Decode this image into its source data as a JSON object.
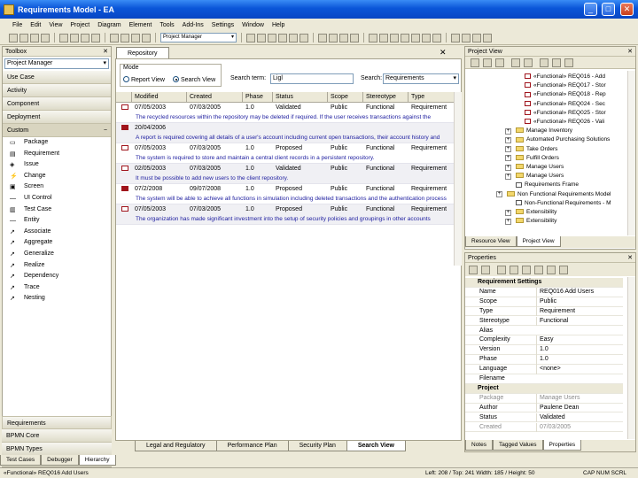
{
  "window": {
    "title": "Requirements Model - EA",
    "min": "_",
    "max": "□",
    "close": "✕"
  },
  "menu": [
    "File",
    "Edit",
    "View",
    "Project",
    "Diagram",
    "Element",
    "Tools",
    "Add-Ins",
    "Settings",
    "Window",
    "Help"
  ],
  "toolbar": {
    "workspace_combo": "Project Manager"
  },
  "toolbox": {
    "title": "Toolbox",
    "close": "✕",
    "perspective": "Project Manager",
    "categories_top": [
      "Use Case",
      "Activity",
      "Component",
      "Deployment"
    ],
    "custom_label": "Custom",
    "tools": [
      {
        "label": "Package",
        "icon": "▭"
      },
      {
        "label": "Requirement",
        "icon": "▤"
      },
      {
        "label": "Issue",
        "icon": "◈"
      },
      {
        "label": "Change",
        "icon": "⚡"
      },
      {
        "label": "Screen",
        "icon": "▣"
      },
      {
        "label": "UI Control",
        "icon": "—"
      },
      {
        "label": "Test Case",
        "icon": "▥"
      },
      {
        "label": "Entity",
        "icon": "—"
      },
      {
        "label": "Associate",
        "icon": "↗"
      },
      {
        "label": "Aggregate",
        "icon": "↗"
      },
      {
        "label": "Generalize",
        "icon": "↗"
      },
      {
        "label": "Realize",
        "icon": "↗"
      },
      {
        "label": "Dependency",
        "icon": "↗"
      },
      {
        "label": "Trace",
        "icon": "↗"
      },
      {
        "label": "Nesting",
        "icon": "↗"
      }
    ],
    "categories_bottom": [
      "Requirements",
      "BPMN Core",
      "BPMN Types"
    ]
  },
  "bottom_left_tabs": [
    "Test Cases",
    "Debugger",
    "Hierarchy"
  ],
  "document": {
    "tab": "Repository",
    "close": "✕",
    "mode": {
      "legend": "Mode",
      "option1": "Report View",
      "option2": "Search View"
    },
    "search_label": "Search term:",
    "search_value": "Ligl",
    "search_in_label": "Search:",
    "search_in_value": "Requirements",
    "columns": [
      "Modified",
      "Created",
      "Phase",
      "Status",
      "Scope",
      "Stereotype",
      "Type"
    ],
    "rows": [
      {
        "modified": "07/05/2003",
        "created": "07/03/2005",
        "phase": "1.0",
        "status": "Validated",
        "scope": "Public",
        "stereotype": "Functional",
        "type": "Requirement",
        "note": "The recycled resources within the repository may be deleted if required. If the user receives transactions against the",
        "flag": "outline",
        "alt": false
      },
      {
        "modified": "20/04/2006",
        "created": "",
        "phase": "",
        "status": "",
        "scope": "",
        "stereotype": "",
        "type": "",
        "note": "A report is required covering all details of a user's account including current open transactions, their account history and",
        "flag": "red",
        "alt": true
      },
      {
        "modified": "07/05/2003",
        "created": "07/03/2005",
        "phase": "1.0",
        "status": "Proposed",
        "scope": "Public",
        "stereotype": "Functional",
        "type": "Requirement",
        "note": "The system is required to store and maintain a central client records in a persistent repository.",
        "flag": "outline",
        "alt": false
      },
      {
        "modified": "02/05/2003",
        "created": "07/03/2005",
        "phase": "1.0",
        "status": "Validated",
        "scope": "Public",
        "stereotype": "Functional",
        "type": "Requirement",
        "note": "It must be possible to add new users to the client repository.",
        "flag": "outline",
        "alt": true
      },
      {
        "modified": "07/2/2008",
        "created": "09/07/2008",
        "phase": "1.0",
        "status": "Proposed",
        "scope": "Public",
        "stereotype": "Functional",
        "type": "Requirement",
        "note": "The system will be able to achieve all functions in simulation including deleted transactions and the authentication process",
        "flag": "red",
        "alt": false
      },
      {
        "modified": "07/05/2003",
        "created": "07/03/2005",
        "phase": "1.0",
        "status": "Proposed",
        "scope": "Public",
        "stereotype": "Functional",
        "type": "Requirement",
        "note": "The organization has made significant investment into the setup of security policies and groupings in other accounts",
        "flag": "outline",
        "alt": true
      }
    ],
    "tabs": [
      "Legal and Regulatory",
      "Performance Plan",
      "Security Plan",
      "Search View"
    ],
    "active_tab": "Search View"
  },
  "project_view": {
    "title": "Project View",
    "close": "✕",
    "items": [
      {
        "label": "«Functional» REQ016 - Add",
        "kind": "req",
        "indent": 2
      },
      {
        "label": "«Functional» REQ017 - Stor",
        "kind": "req",
        "indent": 2
      },
      {
        "label": "«Functional» REQ018 - Rep",
        "kind": "req",
        "indent": 2
      },
      {
        "label": "«Functional» REQ024 - Sec",
        "kind": "req",
        "indent": 2
      },
      {
        "label": "«Functional» REQ025 - Stor",
        "kind": "req",
        "indent": 2
      },
      {
        "label": "«Functional» REQ026 - Vali",
        "kind": "req",
        "indent": 2
      },
      {
        "label": "Manage Inventory",
        "kind": "folder",
        "indent": 1
      },
      {
        "label": "Automated Purchasing Solutions",
        "kind": "folder",
        "indent": 1
      },
      {
        "label": "Take Orders",
        "kind": "folder",
        "indent": 1
      },
      {
        "label": "Fulfill Orders",
        "kind": "folder",
        "indent": 1
      },
      {
        "label": "Manage Users",
        "kind": "folder",
        "indent": 1
      },
      {
        "label": "Manage Users",
        "kind": "folder",
        "indent": 1
      },
      {
        "label": "Requirements Frame",
        "kind": "plain",
        "indent": 1
      },
      {
        "label": "Non Functional Requirements Model",
        "kind": "folder",
        "indent": 0
      },
      {
        "label": "Non-Functional Requirements - M",
        "kind": "plain",
        "indent": 1
      },
      {
        "label": "Extensibility",
        "kind": "folder",
        "indent": 1
      },
      {
        "label": "Extensibility",
        "kind": "folder",
        "indent": 1
      }
    ],
    "tabs": [
      "Resource View",
      "Project View"
    ],
    "active_tab": "Project View"
  },
  "properties": {
    "title": "Properties",
    "close": "✕",
    "rows": [
      {
        "k": "Requirement Settings",
        "v": "",
        "type": "sect"
      },
      {
        "k": "Name",
        "v": "REQ016 Add Users",
        "type": "row"
      },
      {
        "k": "Scope",
        "v": "Public",
        "type": "row"
      },
      {
        "k": "Type",
        "v": "Requirement",
        "type": "row"
      },
      {
        "k": "Stereotype",
        "v": "Functional",
        "type": "row"
      },
      {
        "k": "Alias",
        "v": "",
        "type": "row"
      },
      {
        "k": "Complexity",
        "v": "Easy",
        "type": "row"
      },
      {
        "k": "Version",
        "v": "1.0",
        "type": "row"
      },
      {
        "k": "Phase",
        "v": "1.0",
        "type": "row"
      },
      {
        "k": "Language",
        "v": "<none>",
        "type": "row"
      },
      {
        "k": "Filename",
        "v": "",
        "type": "row"
      },
      {
        "k": "Project",
        "v": "",
        "type": "sect"
      },
      {
        "k": "Package",
        "v": "Manage Users",
        "type": "grey"
      },
      {
        "k": "Author",
        "v": "Paulene Dean",
        "type": "row"
      },
      {
        "k": "Status",
        "v": "Validated",
        "type": "row"
      },
      {
        "k": "Created",
        "v": "07/03/2005",
        "type": "grey"
      }
    ],
    "tabs": [
      "Notes",
      "Tagged Values",
      "Properties"
    ],
    "active_tab": "Properties"
  },
  "status": {
    "left": "«Functional» REQ016 Add Users",
    "right": "Left: 208 / Top: 241   Width: 185 / Height: 50",
    "caps": "CAP NUM SCRL"
  }
}
